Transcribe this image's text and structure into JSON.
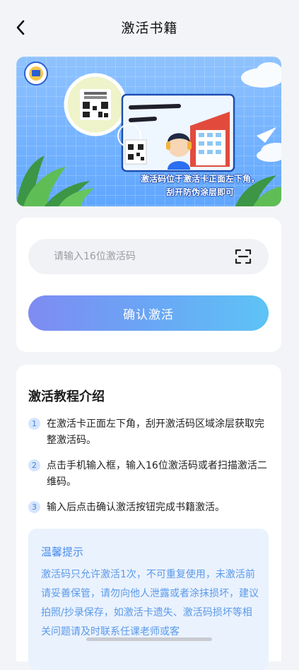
{
  "nav": {
    "title": "激活书籍",
    "back_icon": "chevron-left-icon"
  },
  "banner": {
    "caption_line1": "激活码位于激活卡正面左下角，",
    "caption_line2": "刮开防伪涂层即可",
    "colors": {
      "sky": "#8fc3ff",
      "deep": "#5fa6ff",
      "accent": "#1d4fb3"
    }
  },
  "activation": {
    "input_value": "",
    "input_placeholder": "请输入16位激活码",
    "scan_icon": "scan-icon",
    "confirm_label": "确认激活",
    "gradient": [
      "#7e8bf2",
      "#5ec3f5"
    ]
  },
  "tutorial": {
    "title": "激活教程介绍",
    "steps": [
      {
        "num": "1",
        "text": "在激活卡正面左下角，刮开激活码区域涂层获取完整激活码。"
      },
      {
        "num": "2",
        "text": "点击手机输入框，输入16位激活码或者扫描激活二维码。"
      },
      {
        "num": "3",
        "text": "输入后点击确认激活按钮完成书籍激活。"
      }
    ]
  },
  "tips": {
    "title": "温馨提示",
    "body": "激活码只允许激活1次，不可重复使用，未激活前请妥善保管，请勿向他人泄露或者涂抹损坏，建议拍照/抄录保存，如激活卡遗失、激活码损坏等相关问题请及时联系任课老师或客"
  }
}
